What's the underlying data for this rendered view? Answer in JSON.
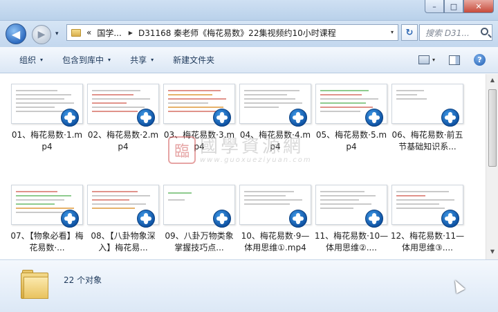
{
  "window": {
    "minimize_glyph": "–",
    "maximize_glyph": "□",
    "close_glyph": "✕"
  },
  "nav": {
    "back_glyph": "◀",
    "forward_glyph": "▶",
    "history_glyph": "▾"
  },
  "address": {
    "overflow": "«",
    "segment1": "国学...",
    "segment2": "D31168 秦老师《梅花易数》22集视频约10小时课程",
    "dropdown_glyph": "▾",
    "refresh_glyph": "↻"
  },
  "search": {
    "placeholder": "搜索 D31..."
  },
  "toolbar": {
    "organize": "组织",
    "include_in_library": "包含到库中",
    "share": "共享",
    "new_folder": "新建文件夹",
    "dropdown_glyph": "▾",
    "help_glyph": "?"
  },
  "files": [
    {
      "label": "01、梅花易数·1.mp4"
    },
    {
      "label": "02、梅花易数·2.mp4"
    },
    {
      "label": "03、梅花易数·3.mp4"
    },
    {
      "label": "04、梅花易数·4.mp4"
    },
    {
      "label": "05、梅花易数·5.mp4"
    },
    {
      "label": "06、梅花易数·前五节基础知识系..."
    },
    {
      "label": "07、【物象必看】梅花易数·..."
    },
    {
      "label": "08、【八卦物象深入】梅花易..."
    },
    {
      "label": "09、八卦万物类象掌握技巧点..."
    },
    {
      "label": "10、梅花易数·9—体用思维①.mp4"
    },
    {
      "label": "11、梅花易数·10—体用思维②...."
    },
    {
      "label": "12、梅花易数·11—体用思维③...."
    }
  ],
  "watermark": {
    "seal": "臨",
    "title": "國學資源網",
    "url": "www.guoxueziyuan.com"
  },
  "details": {
    "count": "22 个对象"
  },
  "scrollbar": {
    "up_glyph": "▲",
    "down_glyph": "▼"
  }
}
